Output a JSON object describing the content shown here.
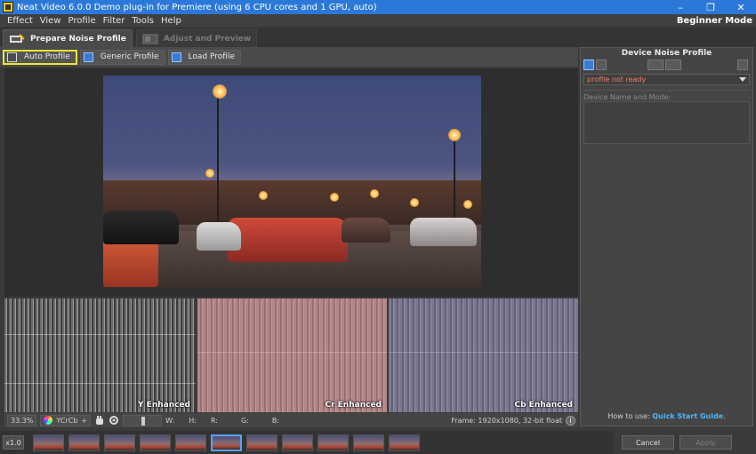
{
  "window": {
    "title": "Neat Video 6.0.0 Demo plug-in for Premiere (using 6 CPU cores and 1 GPU, auto)",
    "minimize": "–",
    "restore": "❐",
    "close": "✕"
  },
  "menubar": {
    "items": [
      "Effect",
      "View",
      "Profile",
      "Filter",
      "Tools",
      "Help"
    ],
    "mode": "Beginner Mode"
  },
  "tabs": [
    {
      "label": "Prepare Noise Profile",
      "active": true
    },
    {
      "label": "Adjust and Preview",
      "active": false
    }
  ],
  "toolbar": {
    "auto_profile": "Auto Profile",
    "generic_profile": "Generic Profile",
    "load_profile": "Load Profile"
  },
  "channels": {
    "y": "Y Enhanced",
    "cr": "Cr Enhanced",
    "cb": "Cb Enhanced"
  },
  "status": {
    "zoom": "33.3%",
    "colorspace": "YCrCb",
    "plus": "+",
    "w_label": "W:",
    "h_label": "H:",
    "r_label": "R:",
    "g_label": "G:",
    "b_label": "B:",
    "frame_info": "Frame: 1920x1080, 32-bit float",
    "info": "i"
  },
  "filmstrip": {
    "speed": "x1.0",
    "thumbnail_count": 11,
    "selected_index": 5
  },
  "right_panel": {
    "title": "Device Noise Profile",
    "profile_status": "profile not ready",
    "device_label": "Device Name and Mode:",
    "howto_prefix": "How to use:",
    "howto_link": "Quick Start Guide",
    "howto_suffix": "."
  },
  "buttons": {
    "cancel": "Cancel",
    "apply": "Apply"
  },
  "colors": {
    "titlebar": "#2b78d8",
    "highlight": "#e8e836",
    "warning": "#f07f6a",
    "link": "#4ab8ff"
  }
}
